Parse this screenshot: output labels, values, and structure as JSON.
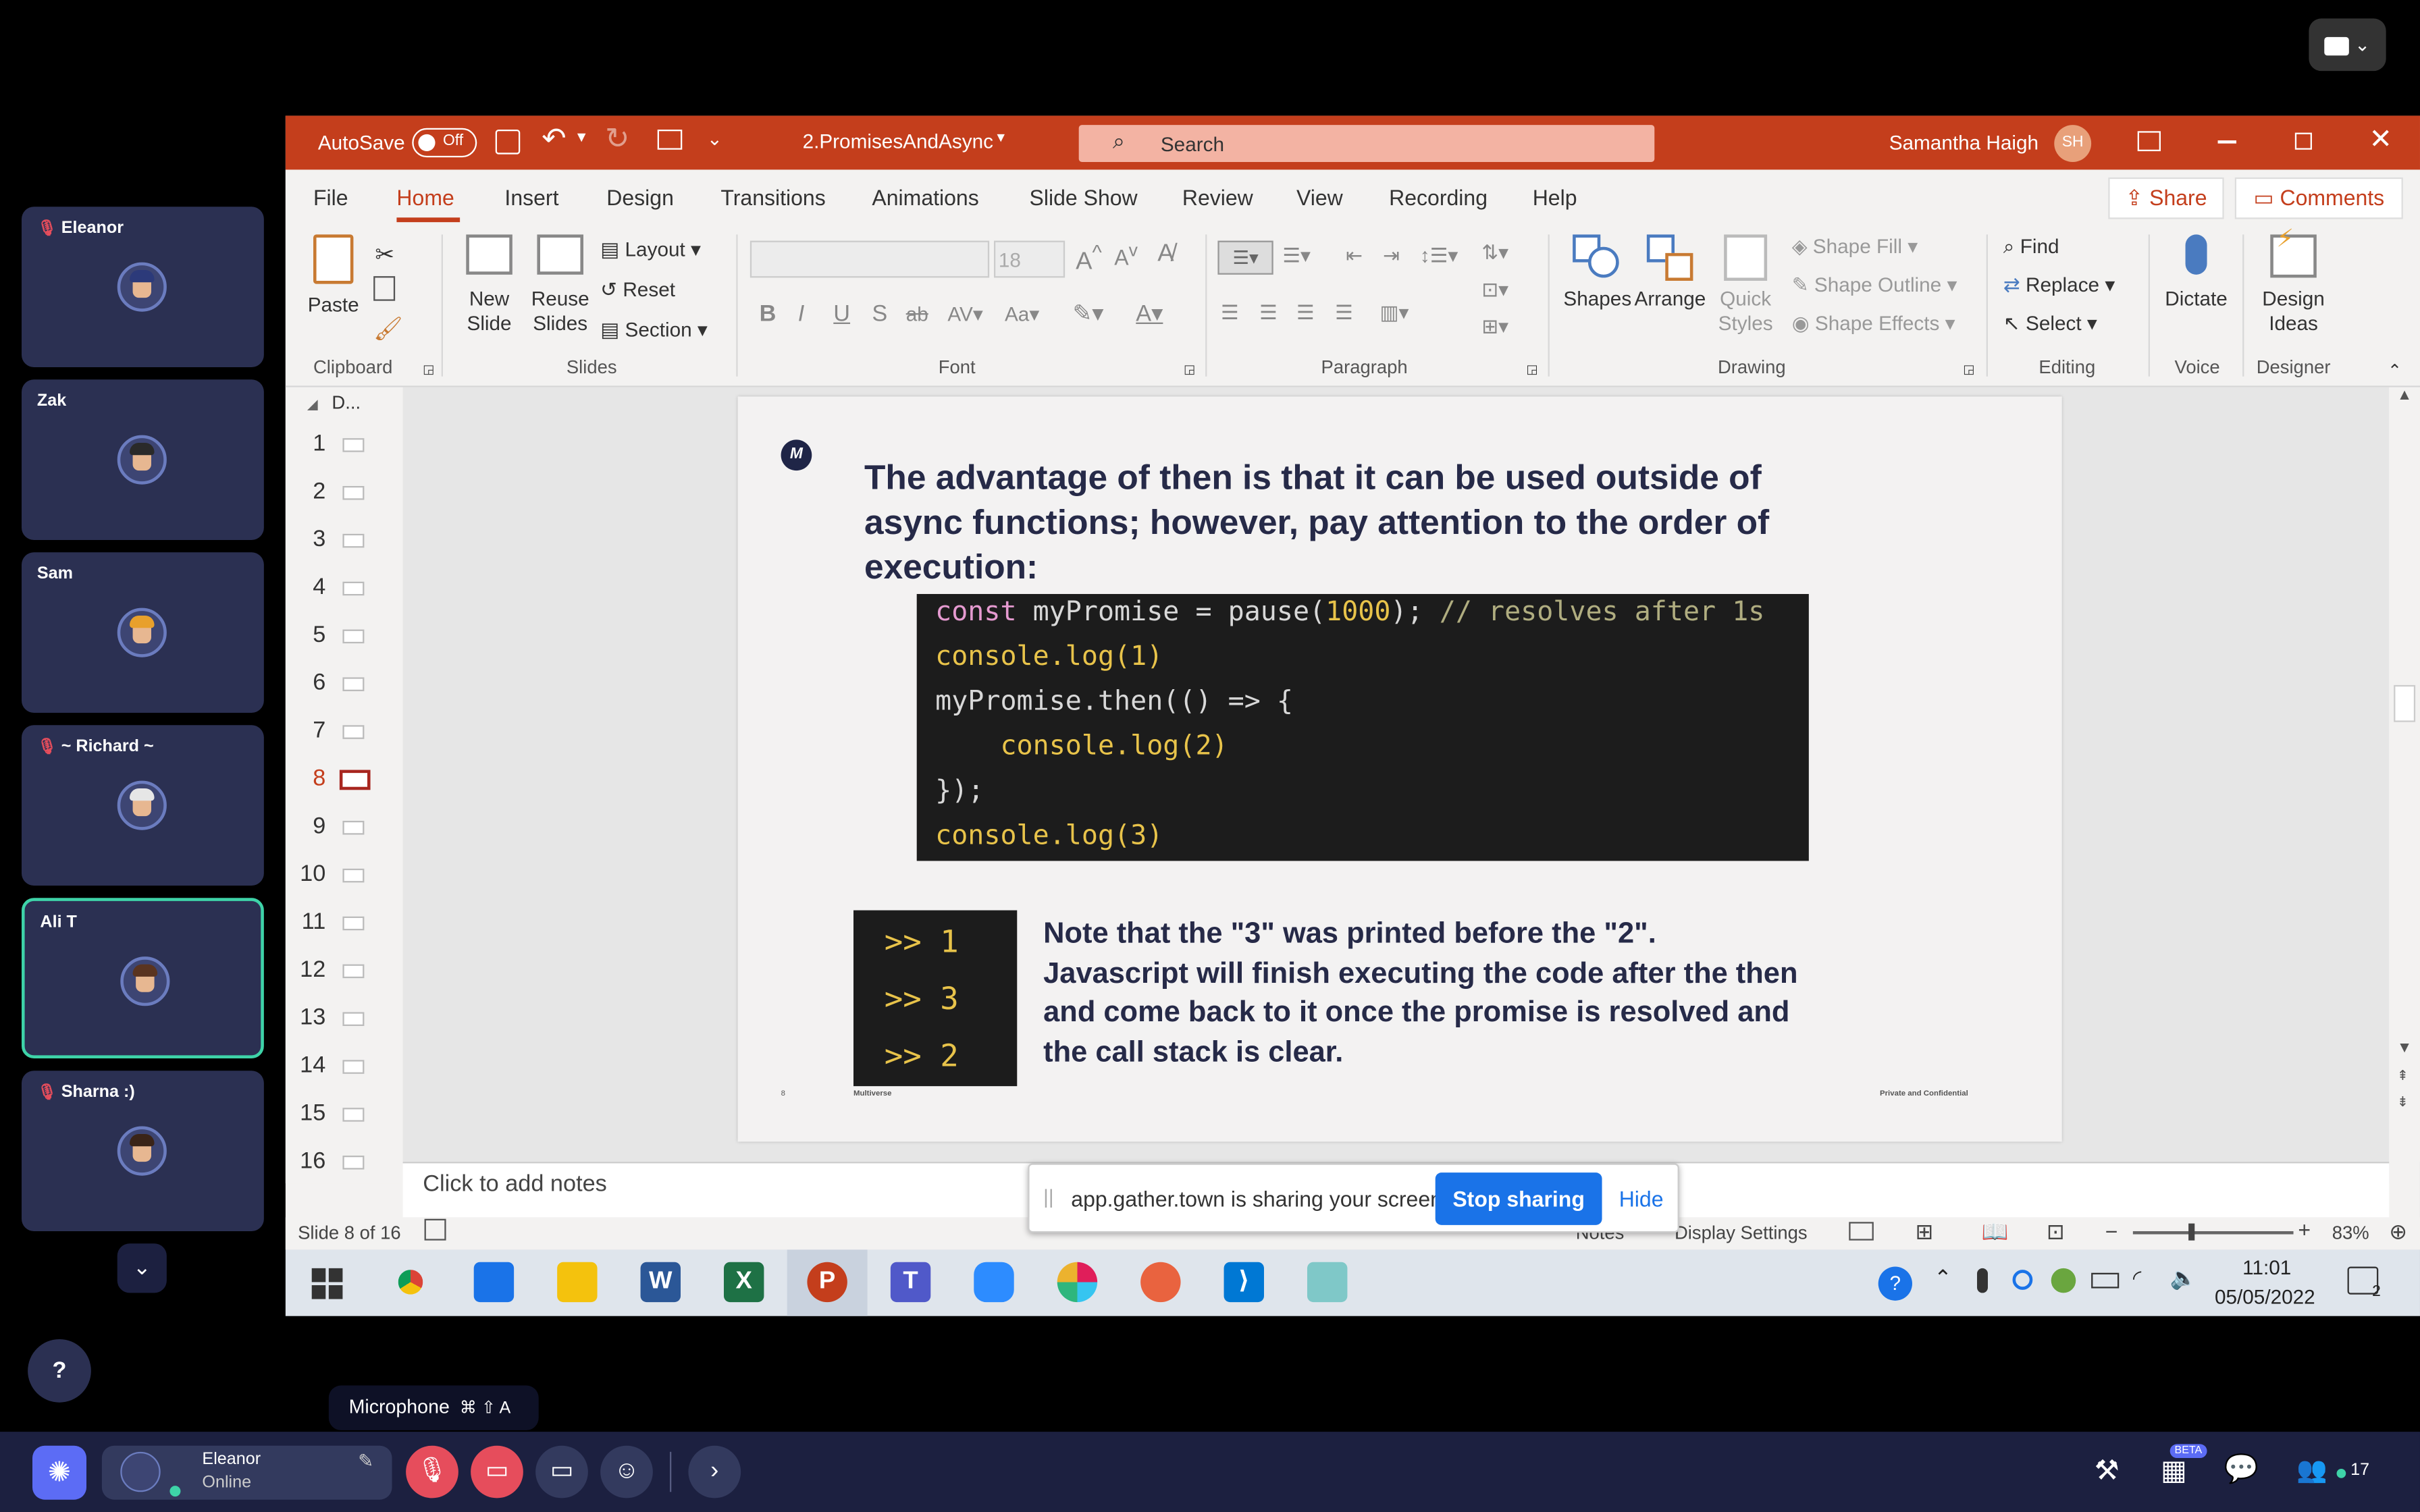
{
  "participants": [
    {
      "name": "Eleanor",
      "muted": true,
      "hair": "#2c3a7a"
    },
    {
      "name": "Zak",
      "muted": false,
      "hair": "#2a2a2a"
    },
    {
      "name": "Sam",
      "muted": false,
      "hair": "#e8a02c"
    },
    {
      "name": "~ Richard ~",
      "muted": true,
      "hair": "#e6e6e6"
    },
    {
      "name": "Ali T",
      "muted": false,
      "hair": "#5a3420"
    },
    {
      "name": "Sharna :)",
      "muted": true,
      "hair": "#3a2418"
    }
  ],
  "ppt": {
    "autosave": "AutoSave",
    "autosave_state": "Off",
    "filename": "2.PromisesAndAsync",
    "search": "Search",
    "user": "Samantha Haigh",
    "user_initials": "SH",
    "tabs": [
      "File",
      "Home",
      "Insert",
      "Design",
      "Transitions",
      "Animations",
      "Slide Show",
      "Review",
      "View",
      "Recording",
      "Help"
    ],
    "share": "Share",
    "comments": "Comments",
    "ribbon": {
      "paste": "Paste",
      "new_slide_1": "New",
      "new_slide_2": "Slide",
      "reuse_1": "Reuse",
      "reuse_2": "Slides",
      "layout": "Layout",
      "reset": "Reset",
      "section": "Section",
      "font_size": "18",
      "shapes": "Shapes",
      "arrange": "Arrange",
      "quick_styles_1": "Quick",
      "quick_styles_2": "Styles",
      "shape_fill": "Shape Fill",
      "shape_outline": "Shape Outline",
      "shape_effects": "Shape Effects",
      "find": "Find",
      "replace": "Replace",
      "select": "Select",
      "dictate": "Dictate",
      "design_ideas_1": "Design",
      "design_ideas_2": "Ideas",
      "groups": [
        "Clipboard",
        "Slides",
        "Font",
        "Paragraph",
        "Drawing",
        "Editing",
        "Voice",
        "Designer"
      ]
    },
    "thumb_header": "D...",
    "slide_numbers": [
      "1",
      "2",
      "3",
      "4",
      "5",
      "6",
      "7",
      "8",
      "9",
      "10",
      "11",
      "12",
      "13",
      "14",
      "15",
      "16"
    ],
    "current_slide": "8",
    "slide": {
      "logo": "M",
      "title_lines": [
        "The advantage of then is that it can be used outside of",
        "async functions; however, pay attention to the order of",
        "execution:"
      ],
      "code": {
        "l1_kw": "const",
        "l1_a": " myPromise = pause(",
        "l1_num": "1000",
        "l1_b": "); ",
        "l1_comment": "// resolves after 1s",
        "l2_a": "console.log(",
        "l2_num": "1",
        "l2_b": ")",
        "l3": "myPromise.then(() => {",
        "l4_a": "    console.log(",
        "l4_num": "2",
        "l4_b": ")",
        "l5": "});",
        "l6_a": "console.log(",
        "l6_num": "3",
        "l6_b": ")"
      },
      "output": [
        ">> 1",
        ">> 3",
        ">> 2"
      ],
      "note_lines": [
        "Note that the \"3\" was printed before the \"2\".",
        "Javascript will finish executing the code after the then",
        "and come back to it once the promise is resolved and",
        "the call stack is clear."
      ],
      "footer_num": "8",
      "footer_brand": "Multiverse",
      "footer_conf": "Private and Confidential"
    },
    "notes_placeholder": "Click to add notes",
    "status": {
      "slide_of": "Slide 8 of 16",
      "notes": "Notes",
      "display": "Display Settings",
      "zoom": "83%"
    }
  },
  "share_banner": {
    "text": "app.gather.town is sharing your screen.",
    "stop": "Stop sharing",
    "hide": "Hide"
  },
  "taskbar": {
    "time": "11:01",
    "date": "05/05/2022",
    "notif_count": "2"
  },
  "gather": {
    "tooltip": "Microphone",
    "tooltip_keys": "⌘ ⇧ A",
    "user": "Eleanor",
    "status": "Online",
    "beta": "BETA",
    "online_count": "17",
    "help": "?"
  }
}
